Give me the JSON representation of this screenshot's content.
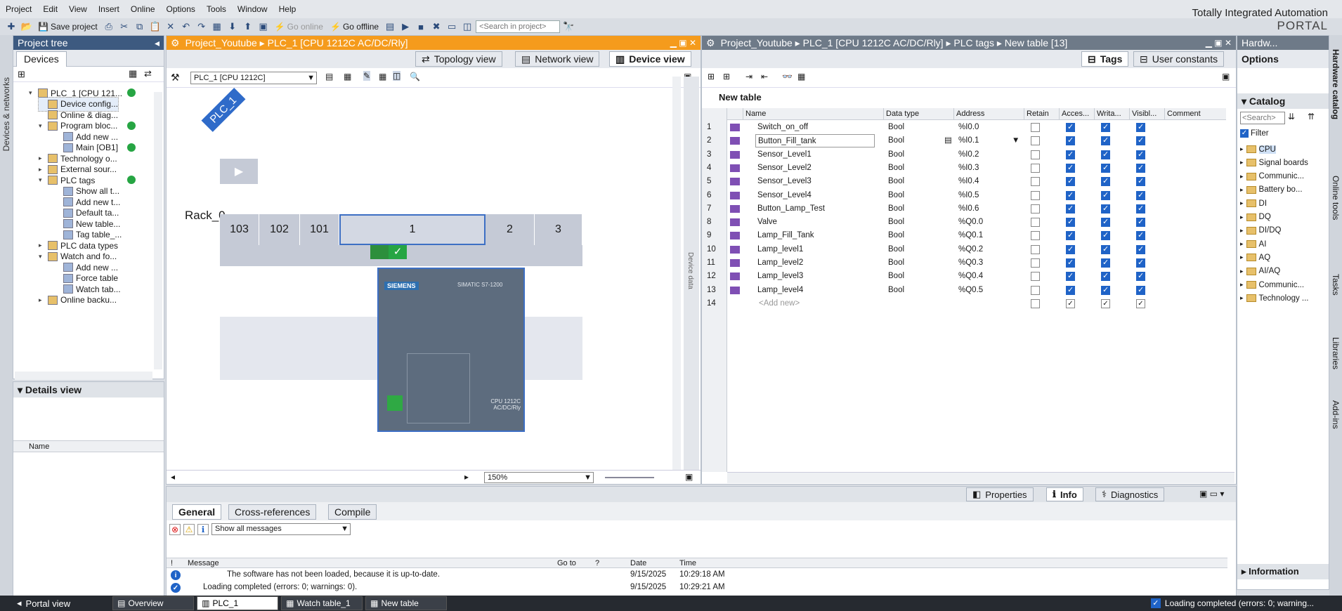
{
  "menu": [
    "Project",
    "Edit",
    "View",
    "Insert",
    "Online",
    "Options",
    "Tools",
    "Window",
    "Help"
  ],
  "brand": {
    "line1": "Totally Integrated Automation",
    "line2": "PORTAL"
  },
  "toolbar": {
    "save_label": "Save project",
    "go_online": "Go online",
    "go_offline": "Go offline",
    "search_placeholder": "<Search in project>"
  },
  "left_vertical_tab": "Devices & networks",
  "project_tree": {
    "title": "Project tree",
    "tab": "Devices",
    "items": [
      {
        "label": "PLC_1 [CPU 121...",
        "level": 1,
        "status": true
      },
      {
        "label": "Device config...",
        "level": 2,
        "status": false
      },
      {
        "label": "Online & diag...",
        "level": 2,
        "status": false
      },
      {
        "label": "Program bloc...",
        "level": 2,
        "status": true
      },
      {
        "label": "Add new ...",
        "level": 3,
        "status": false
      },
      {
        "label": "Main [OB1]",
        "level": 3,
        "status": true
      },
      {
        "label": "Technology o...",
        "level": 2,
        "status": false
      },
      {
        "label": "External sour...",
        "level": 2,
        "status": false
      },
      {
        "label": "PLC tags",
        "level": 2,
        "status": true
      },
      {
        "label": "Show all t...",
        "level": 3,
        "status": false
      },
      {
        "label": "Add new t...",
        "level": 3,
        "status": false
      },
      {
        "label": "Default ta...",
        "level": 3,
        "status": false
      },
      {
        "label": "New table...",
        "level": 3,
        "status": false
      },
      {
        "label": "Tag table_...",
        "level": 3,
        "status": false
      },
      {
        "label": "PLC data types",
        "level": 2,
        "status": false
      },
      {
        "label": "Watch and fo...",
        "level": 2,
        "status": false
      },
      {
        "label": "Add new ...",
        "level": 3,
        "status": false
      },
      {
        "label": "Force table",
        "level": 3,
        "status": false
      },
      {
        "label": "Watch tab...",
        "level": 3,
        "status": false
      },
      {
        "label": "Online backu...",
        "level": 2,
        "status": false
      }
    ]
  },
  "details_view": {
    "title": "Details view",
    "col_name": "Name"
  },
  "editor": {
    "breadcrumb": "Project_Youtube  ▸  PLC_1 [CPU 1212C AC/DC/Rly]",
    "tabs": [
      "Topology view",
      "Network view",
      "Device view"
    ],
    "device_select": "PLC_1 [CPU 1212C]",
    "plc_label": "PLC_1",
    "rack_label": "Rack_0",
    "slots": [
      "103",
      "102",
      "101",
      "1",
      "2",
      "3"
    ],
    "zoom": "150%",
    "device_data_tab": "Device data",
    "cpu_brand": "SIEMENS",
    "cpu_model": "SIMATIC S7-1200",
    "cpu_type": "CPU 1212C AC/DC/Rly"
  },
  "tags": {
    "breadcrumb": "Project_Youtube  ▸  PLC_1 [CPU 1212C AC/DC/Rly]  ▸  PLC tags  ▸  New table [13]",
    "tabs": [
      "Tags",
      "User constants"
    ],
    "table_title": "New table",
    "columns": [
      "Name",
      "Data type",
      "Address",
      "Retain",
      "Acces...",
      "Writa...",
      "Visibl...",
      "Comment"
    ],
    "rows": [
      {
        "n": "1",
        "name": "Switch_on_off",
        "type": "Bool",
        "addr": "%I0.0"
      },
      {
        "n": "2",
        "name": "Button_Fill_tank",
        "type": "Bool",
        "addr": "%I0.1"
      },
      {
        "n": "3",
        "name": "Sensor_Level1",
        "type": "Bool",
        "addr": "%I0.2"
      },
      {
        "n": "4",
        "name": "Sensor_Level2",
        "type": "Bool",
        "addr": "%I0.3"
      },
      {
        "n": "5",
        "name": "Sensor_Level3",
        "type": "Bool",
        "addr": "%I0.4"
      },
      {
        "n": "6",
        "name": "Sensor_Level4",
        "type": "Bool",
        "addr": "%I0.5"
      },
      {
        "n": "7",
        "name": "Button_Lamp_Test",
        "type": "Bool",
        "addr": "%I0.6"
      },
      {
        "n": "8",
        "name": "Valve",
        "type": "Bool",
        "addr": "%Q0.0"
      },
      {
        "n": "9",
        "name": "Lamp_Fill_Tank",
        "type": "Bool",
        "addr": "%Q0.1"
      },
      {
        "n": "10",
        "name": "Lamp_level1",
        "type": "Bool",
        "addr": "%Q0.2"
      },
      {
        "n": "11",
        "name": "Lamp_level2",
        "type": "Bool",
        "addr": "%Q0.3"
      },
      {
        "n": "12",
        "name": "Lamp_level3",
        "type": "Bool",
        "addr": "%Q0.4"
      },
      {
        "n": "13",
        "name": "Lamp_level4",
        "type": "Bool",
        "addr": "%Q0.5"
      }
    ],
    "add_new": {
      "n": "14",
      "name": "<Add new>"
    }
  },
  "catalog": {
    "title": "Hardw...",
    "options": "Options",
    "catalog_label": "Catalog",
    "search": "<Search>",
    "filter": "Filter",
    "items": [
      "CPU",
      "Signal boards",
      "Communic...",
      "Battery bo...",
      "DI",
      "DQ",
      "DI/DQ",
      "AI",
      "AQ",
      "AI/AQ",
      "Communic...",
      "Technology ..."
    ],
    "information": "Information"
  },
  "right_vertical_tabs": [
    "Hardware catalog",
    "Online tools",
    "Tasks",
    "Libraries",
    "Add-ins"
  ],
  "inspector": {
    "tabs_right": [
      "Properties",
      "Info",
      "Diagnostics"
    ],
    "tabs_left": [
      "General",
      "Cross-references",
      "Compile"
    ],
    "filter": "Show all messages",
    "columns": [
      "!",
      "Message",
      "Go to",
      "?",
      "Date",
      "Time"
    ],
    "messages": [
      {
        "msg": "The software has not been loaded, because it is up-to-date.",
        "date": "9/15/2025",
        "time": "10:29:18 AM"
      },
      {
        "msg": "Loading completed (errors: 0; warnings: 0).",
        "date": "9/15/2025",
        "time": "10:29:21 AM"
      }
    ]
  },
  "statusbar": {
    "portal": "Portal view",
    "tabs": [
      "Overview",
      "PLC_1",
      "Watch table_1",
      "New table"
    ],
    "status": "Loading completed (errors: 0; warning..."
  }
}
